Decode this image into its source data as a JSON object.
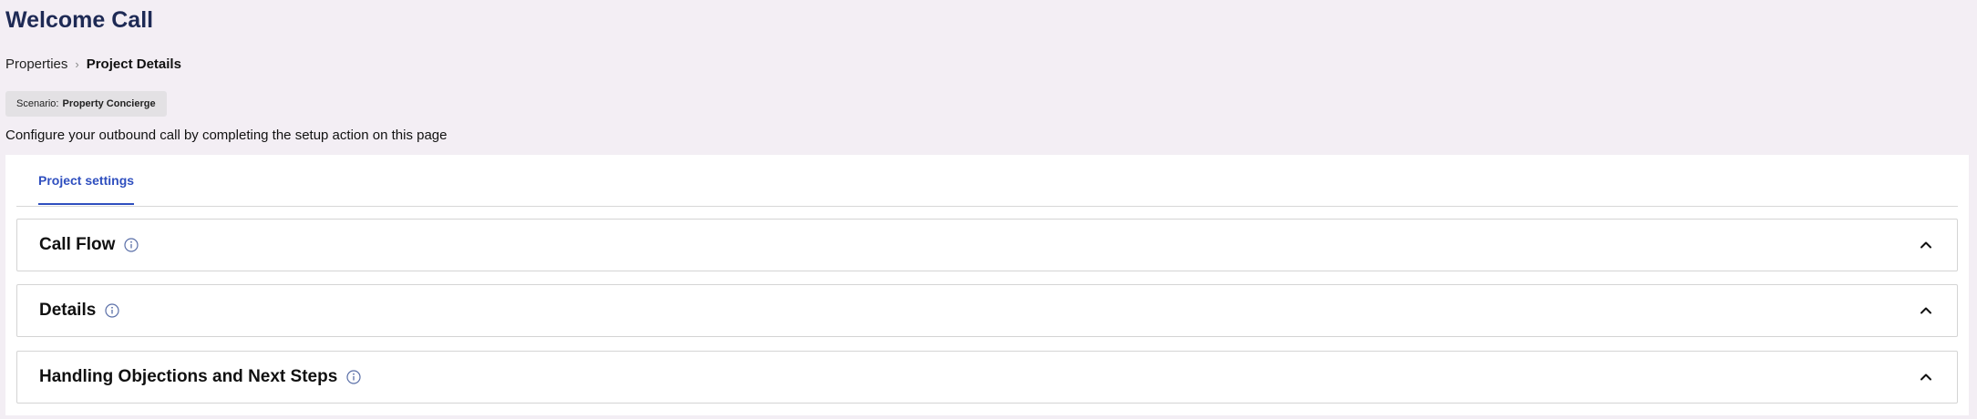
{
  "page": {
    "title": "Welcome Call"
  },
  "breadcrumb": {
    "items": [
      {
        "label": "Properties"
      },
      {
        "label": "Project Details"
      }
    ],
    "separator": "›"
  },
  "scenario": {
    "label": "Scenario:",
    "value": "Property Concierge"
  },
  "intro": {
    "text": "Configure your outbound call by completing the setup action on this page"
  },
  "tabs": [
    {
      "label": "Project settings",
      "active": true
    }
  ],
  "sections": [
    {
      "title": "Call Flow",
      "icon": "info-icon",
      "expanded": true
    },
    {
      "title": "Details",
      "icon": "info-icon",
      "expanded": true
    },
    {
      "title": "Handling Objections and Next Steps",
      "icon": "info-icon",
      "expanded": true
    }
  ],
  "colors": {
    "background": "#f3eef4",
    "title": "#1e2a55",
    "accent": "#2f4fbf",
    "badge": "#e3e1e4"
  }
}
